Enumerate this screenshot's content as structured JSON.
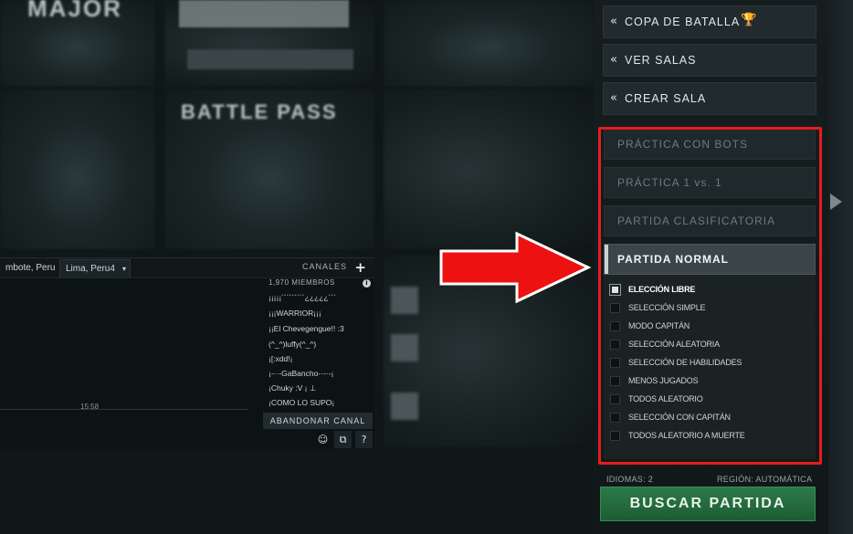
{
  "nav": {
    "buttons": [
      {
        "label": "COPA DE BATALLA"
      },
      {
        "label": "VER SALAS"
      },
      {
        "label": "CREAR SALA"
      }
    ]
  },
  "modes": {
    "items": [
      {
        "label": "PRÁCTICA CON BOTS"
      },
      {
        "label": "PRÁCTICA 1 vs. 1"
      },
      {
        "label": "PARTIDA CLASIFICATORIA"
      },
      {
        "label": "PARTIDA NORMAL"
      }
    ],
    "selected": "PARTIDA NORMAL",
    "options": [
      {
        "label": "ELECCIÓN LIBRE",
        "checked": true
      },
      {
        "label": "SELECCIÓN SIMPLE",
        "checked": false
      },
      {
        "label": "MODO CAPITÁN",
        "checked": false
      },
      {
        "label": "SELECCIÓN ALEATORIA",
        "checked": false
      },
      {
        "label": "SELECCIÓN DE HABILIDADES",
        "checked": false
      },
      {
        "label": "MENOS JUGADOS",
        "checked": false
      },
      {
        "label": "TODOS ALEATORIO",
        "checked": false
      },
      {
        "label": "SELECCIÓN CON CAPITÁN",
        "checked": false
      },
      {
        "label": "TODOS ALEATORIO A MUERTE",
        "checked": false
      }
    ]
  },
  "footer": {
    "languages": "IDIOMAS: 2",
    "region": "REGIÓN: AUTOMÁTICA",
    "find_match": "BUSCAR PARTIDA"
  },
  "chat": {
    "tabs": [
      "mbote, Peru",
      "Lima, Peru4"
    ],
    "channels_label": "CANALES",
    "members_count": "1,970 MIEMBROS",
    "members": [
      "¡¡¡¡¡´´´´´´´´´¿¿¿¿¿´´´",
      "¡¡¡WARRIOR¡¡¡",
      "¡¡El Chevegengue!! :3",
      "(^_^)luffy(^_^)",
      "¡[:xdd!¡",
      "¡-··-GaBancho-·-·-¡",
      "¡Chuky :V ¡ ⊥",
      "¡COMO LO SUPO¡"
    ],
    "timestamp": "15:58",
    "leave_channel": "ABANDONAR CANAL"
  },
  "background": {
    "major_text": "MAJOR",
    "battlepass_text": "BATTLE PASS"
  },
  "colors": {
    "highlight": "#e51d1d",
    "find_button": "#2c7a48",
    "arrow": "#ee1111"
  }
}
